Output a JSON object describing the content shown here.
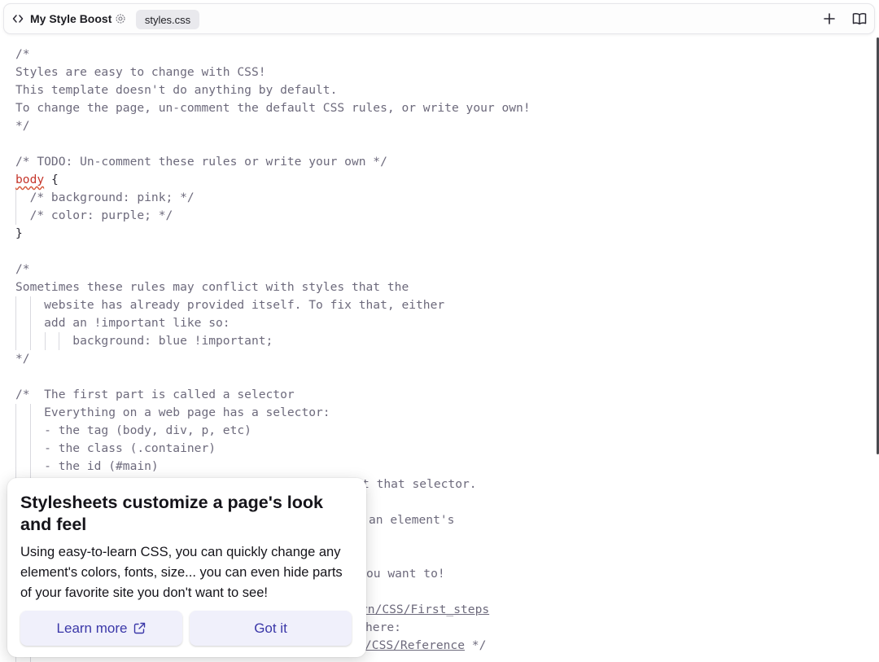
{
  "toolbar": {
    "title": "My Style Boost",
    "file_tab": "styles.css"
  },
  "editor": {
    "lines": [
      "/*",
      "Styles are easy to change with CSS!",
      "This template doesn't do anything by default.",
      "To change the page, un-comment the default CSS rules, or write your own!",
      "*/",
      "",
      "/* TODO: Un-comment these rules or write your own */",
      "body",
      " {",
      "  /* background: pink; */",
      "  /* color: purple; */",
      "}",
      "",
      "/*",
      "Sometimes these rules may conflict with styles that the",
      "    website has already provided itself. To fix that, either",
      "    add an !important like so:",
      "        background: blue !important;",
      "*/",
      "",
      "/*  The first part is called a selector",
      "    Everything on a web page has a selector:",
      "    - the tag (body, div, p, etc)",
      "    - the class (.container)",
      "    - the id (#main)",
      "t that selector.",
      "an element's",
      "ou want to!",
      "rn/CSS/First_steps",
      "here:",
      "/CSS/Reference",
      " */"
    ]
  },
  "popup": {
    "title": "Stylesheets customize a page's look and feel",
    "body": "Using easy-to-learn CSS, you can quickly change any element's colors, fonts, size... you can even hide parts of your favorite site you don't want to see!",
    "learn_more": "Learn more",
    "got_it": "Got it"
  },
  "colors": {
    "accent": "#3a37a8",
    "selector": "#c5352b",
    "comment": "#6d6a7c"
  }
}
